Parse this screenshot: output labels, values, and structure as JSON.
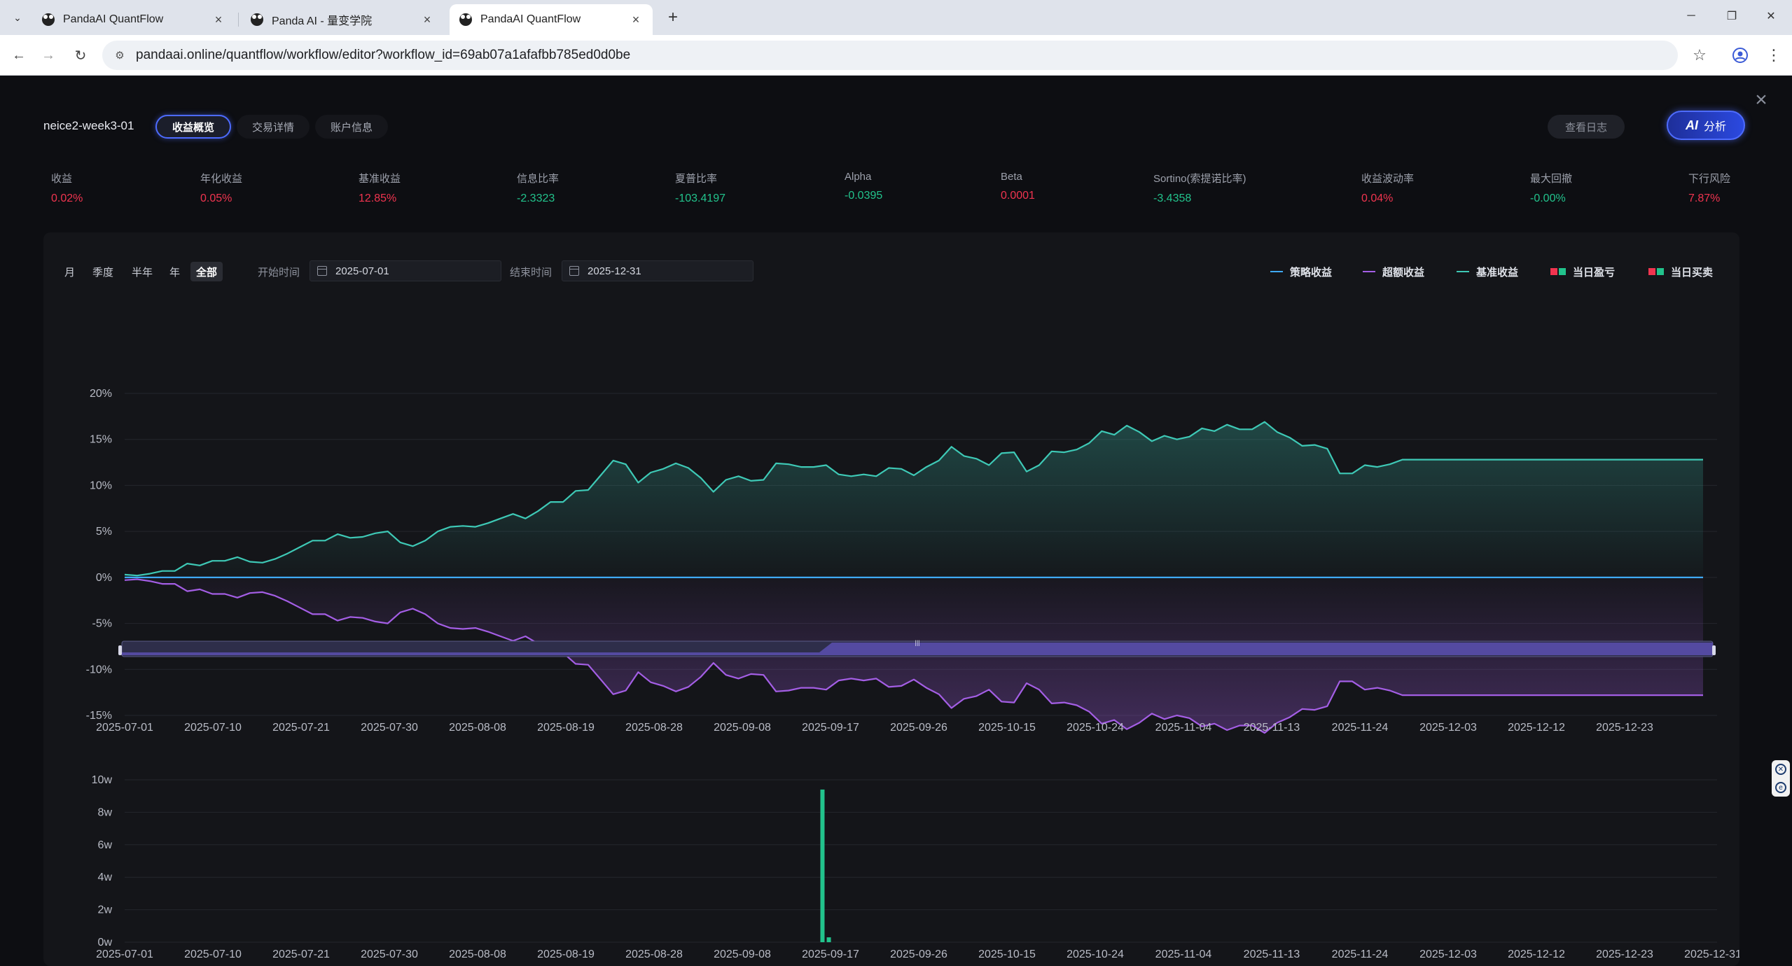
{
  "browser": {
    "tabs": [
      {
        "title": "PandaAI QuantFlow",
        "active": false
      },
      {
        "title": "Panda AI - 量变学院",
        "active": false
      },
      {
        "title": "PandaAI QuantFlow",
        "active": true
      }
    ],
    "url": "pandaai.online/quantflow/workflow/editor?workflow_id=69ab07a1afafbb785ed0d0be"
  },
  "header": {
    "strategy_name": "neice2-week3-01",
    "tabs": [
      "收益概览",
      "交易详情",
      "账户信息"
    ],
    "active_tab": 0,
    "log_button": "查看日志",
    "ai_button": "分析",
    "ai_icon_text": "AI"
  },
  "metrics": [
    {
      "label": "收益",
      "value": "0.02%",
      "tone": "red"
    },
    {
      "label": "年化收益",
      "value": "0.05%",
      "tone": "red"
    },
    {
      "label": "基准收益",
      "value": "12.85%",
      "tone": "red"
    },
    {
      "label": "信息比率",
      "value": "-2.3323",
      "tone": "green"
    },
    {
      "label": "夏普比率",
      "value": "-103.4197",
      "tone": "green"
    },
    {
      "label": "Alpha",
      "value": "-0.0395",
      "tone": "green"
    },
    {
      "label": "Beta",
      "value": "0.0001",
      "tone": "red"
    },
    {
      "label": "Sortino(索提诺比率)",
      "value": "-3.4358",
      "tone": "green"
    },
    {
      "label": "收益波动率",
      "value": "0.04%",
      "tone": "red"
    },
    {
      "label": "最大回撤",
      "value": "-0.00%",
      "tone": "green"
    },
    {
      "label": "下行风险",
      "value": "7.87%",
      "tone": "red"
    }
  ],
  "filters": {
    "periods": [
      "月",
      "季度",
      "半年",
      "年",
      "全部"
    ],
    "active_period": 4,
    "start_label": "开始时间",
    "start_value": "2025-07-01",
    "end_label": "结束时间",
    "end_value": "2025-12-31"
  },
  "legend": [
    {
      "name": "策略收益",
      "kind": "line",
      "color": "#3fa9f5"
    },
    {
      "name": "超额收益",
      "kind": "line",
      "color": "#a45ee5"
    },
    {
      "name": "基准收益",
      "kind": "line",
      "color": "#3ec9b6"
    },
    {
      "name": "当日盈亏",
      "kind": "square",
      "colors": [
        "#f0344f",
        "#22c38c"
      ]
    },
    {
      "name": "当日买卖",
      "kind": "square",
      "colors": [
        "#f0344f",
        "#22c38c"
      ]
    }
  ],
  "colors": {
    "strategy": "#3fa9f5",
    "excess": "#a45ee5",
    "benchmark": "#3ec9b6",
    "bar": "#22c38c"
  },
  "chart_data": [
    {
      "type": "line",
      "x_ticks": [
        "2025-07-01",
        "2025-07-10",
        "2025-07-21",
        "2025-07-30",
        "2025-08-08",
        "2025-08-19",
        "2025-08-28",
        "2025-09-08",
        "2025-09-17",
        "2025-09-26",
        "2025-10-15",
        "2025-10-24",
        "2025-11-04",
        "2025-11-13",
        "2025-11-24",
        "2025-12-03",
        "2025-12-12",
        "2025-12-23"
      ],
      "y_ticks": [
        "20%",
        "15%",
        "10%",
        "5%",
        "0%",
        "-5%",
        "-10%",
        "-15%"
      ],
      "ylim": [
        -15,
        20
      ],
      "series": [
        {
          "name": "基准收益",
          "values": [
            0.3,
            0.2,
            0.4,
            0.7,
            0.7,
            1.5,
            1.3,
            1.8,
            1.8,
            2.2,
            1.7,
            1.6,
            2.0,
            2.6,
            3.3,
            4.0,
            4.0,
            4.7,
            4.3,
            4.4,
            4.8,
            5.0,
            3.8,
            3.4,
            4.0,
            5.0,
            5.5,
            5.6,
            5.5,
            5.9,
            6.4,
            6.9,
            6.4,
            7.2,
            8.2,
            8.2,
            9.4,
            9.5,
            11.1,
            12.7,
            12.3,
            10.3,
            11.4,
            11.8,
            12.4,
            11.9,
            10.8,
            9.3,
            10.6,
            11.0,
            10.5,
            10.6,
            12.4,
            12.3,
            12.0,
            12.0,
            12.2,
            11.2,
            11.0,
            11.2,
            11.0,
            11.9,
            11.8,
            11.1,
            12.0,
            12.7,
            14.2,
            13.2,
            12.9,
            12.2,
            13.5,
            13.6,
            11.5,
            12.2,
            13.7,
            13.6,
            13.9,
            14.6,
            15.9,
            15.5,
            16.5,
            15.8,
            14.8,
            15.4,
            15.0,
            15.3,
            16.2,
            15.9,
            16.6,
            16.1,
            16.1,
            16.9,
            15.8,
            15.2,
            14.3,
            14.4,
            14.0,
            11.3,
            11.3,
            12.2,
            12.0,
            12.3,
            12.8,
            12.8,
            12.8,
            12.8,
            12.8,
            12.8,
            12.8,
            12.8,
            12.8,
            12.8,
            12.8,
            12.8,
            12.8,
            12.8,
            12.8,
            12.8,
            12.8,
            12.8,
            12.8,
            12.8,
            12.8,
            12.8,
            12.8,
            12.8,
            12.8
          ]
        },
        {
          "name": "超额收益",
          "values": [
            -0.3,
            -0.2,
            -0.4,
            -0.7,
            -0.7,
            -1.5,
            -1.3,
            -1.8,
            -1.8,
            -2.2,
            -1.7,
            -1.6,
            -2.0,
            -2.6,
            -3.3,
            -4.0,
            -4.0,
            -4.7,
            -4.3,
            -4.4,
            -4.8,
            -5.0,
            -3.8,
            -3.4,
            -4.0,
            -5.0,
            -5.5,
            -5.6,
            -5.5,
            -5.9,
            -6.4,
            -6.9,
            -6.4,
            -7.2,
            -8.2,
            -8.2,
            -9.4,
            -9.5,
            -11.1,
            -12.7,
            -12.3,
            -10.3,
            -11.4,
            -11.8,
            -12.4,
            -11.9,
            -10.8,
            -9.3,
            -10.6,
            -11.0,
            -10.5,
            -10.6,
            -12.4,
            -12.3,
            -12.0,
            -12.0,
            -12.2,
            -11.2,
            -11.0,
            -11.2,
            -11.0,
            -11.9,
            -11.8,
            -11.1,
            -12.0,
            -12.7,
            -14.2,
            -13.2,
            -12.9,
            -12.2,
            -13.5,
            -13.6,
            -11.5,
            -12.2,
            -13.7,
            -13.6,
            -13.9,
            -14.6,
            -15.9,
            -15.5,
            -16.5,
            -15.8,
            -14.8,
            -15.4,
            -15.0,
            -15.3,
            -16.2,
            -15.9,
            -16.6,
            -16.1,
            -16.1,
            -16.9,
            -15.8,
            -15.2,
            -14.3,
            -14.4,
            -14.0,
            -11.3,
            -11.3,
            -12.2,
            -12.0,
            -12.3,
            -12.8,
            -12.8,
            -12.8,
            -12.8,
            -12.8,
            -12.8,
            -12.8,
            -12.8,
            -12.8,
            -12.8,
            -12.8,
            -12.8,
            -12.8,
            -12.8,
            -12.8,
            -12.8,
            -12.8,
            -12.8,
            -12.8,
            -12.8,
            -12.8,
            -12.8,
            -12.8,
            -12.8,
            -12.8
          ]
        },
        {
          "name": "策略收益",
          "values": [
            0,
            0
          ]
        }
      ]
    },
    {
      "type": "bar",
      "x_ticks": [
        "2025-07-01",
        "2025-07-10",
        "2025-07-21",
        "2025-07-30",
        "2025-08-08",
        "2025-08-19",
        "2025-08-28",
        "2025-09-08",
        "2025-09-17",
        "2025-09-26",
        "2025-10-15",
        "2025-10-24",
        "2025-11-04",
        "2025-11-13",
        "2025-11-24",
        "2025-12-03",
        "2025-12-12",
        "2025-12-23",
        "2025-12-31"
      ],
      "y_ticks": [
        "10w",
        "8w",
        "6w",
        "4w",
        "2w",
        "0w"
      ],
      "ylim": [
        0,
        100000
      ],
      "bars": [
        {
          "position": 0.4382,
          "value": 94000
        },
        {
          "position": 0.4422,
          "value": 3000
        }
      ]
    }
  ]
}
